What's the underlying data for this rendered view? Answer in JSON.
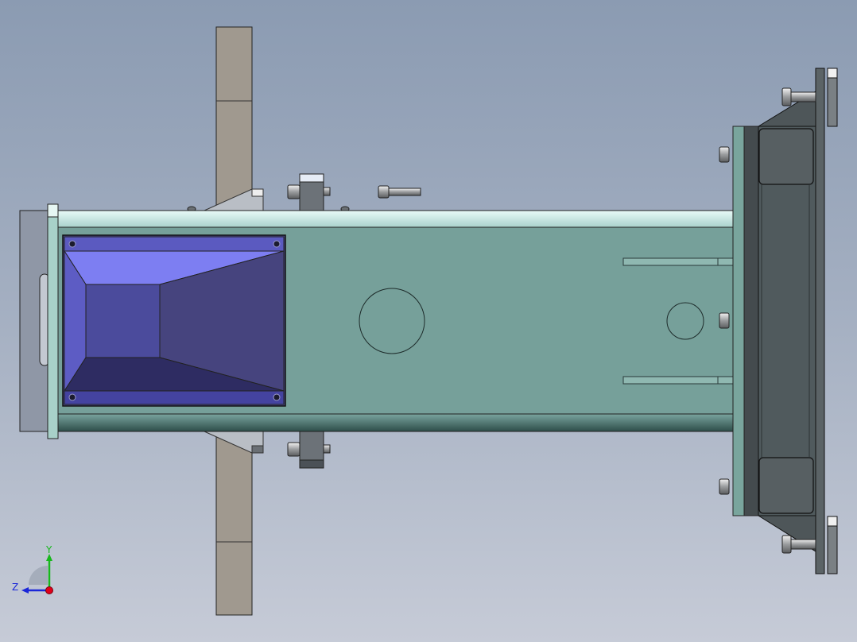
{
  "viewport": {
    "background_top": "#8b9bb2",
    "background_bottom": "#c6cbd7"
  },
  "model": {
    "beam_color": "#76a09a",
    "beam_highlight": "#dff3f1",
    "hopper_color": "#4a4890",
    "hopper_highlight": "#7d7ef2",
    "plate_color": "#9f9993",
    "dark_housing": "#4e5659",
    "bolt_color": "#c4c6c8"
  },
  "triad": {
    "y_label": "Y",
    "z_label": "Z",
    "x_color": "#e0001a",
    "y_color": "#17b81c",
    "z_color": "#1a26d8"
  }
}
